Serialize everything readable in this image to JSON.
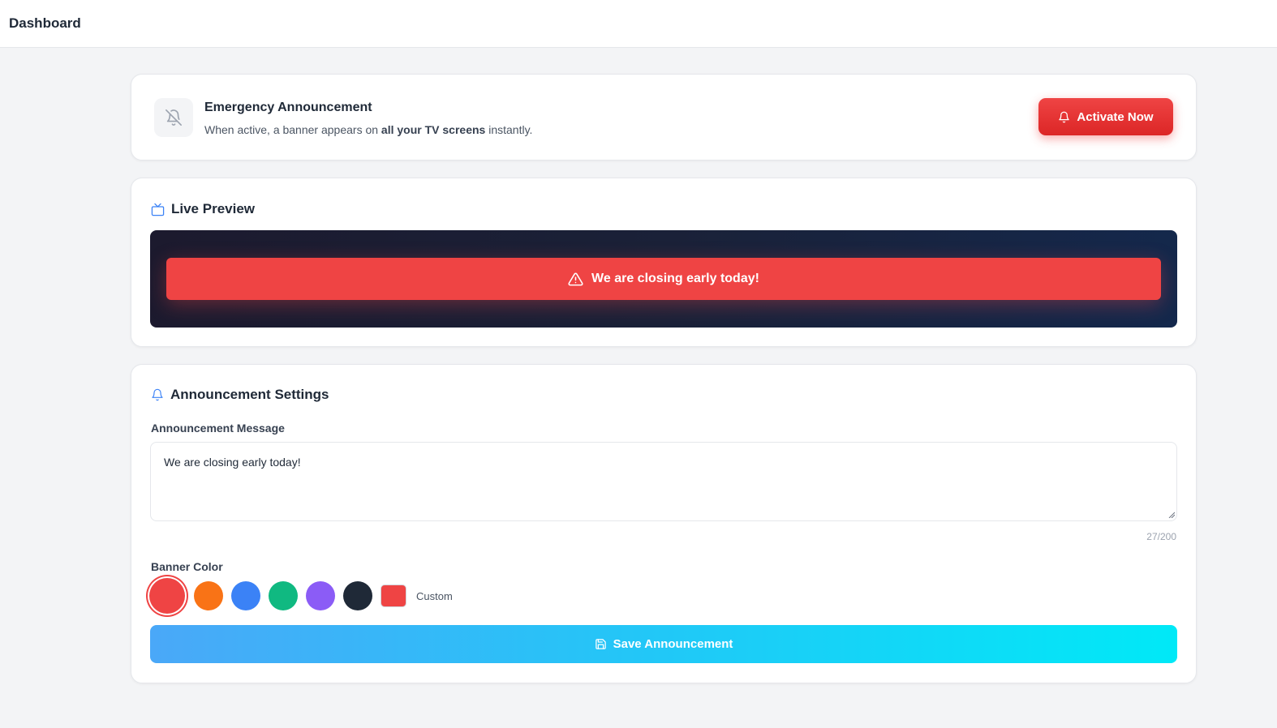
{
  "topbar": {
    "title": "Dashboard"
  },
  "emergency": {
    "title": "Emergency Announcement",
    "desc_prefix": "When active, a banner appears on ",
    "desc_bold": "all your TV screens",
    "desc_suffix": " instantly.",
    "activate_label": "Activate Now",
    "icon": "bell-off-icon"
  },
  "preview": {
    "heading": "Live Preview",
    "heading_icon": "tv-icon",
    "banner_text": "We are closing early today!",
    "banner_icon": "warning-triangle-icon",
    "banner_color": "#ef4444"
  },
  "settings": {
    "heading": "Announcement Settings",
    "heading_icon": "bell-icon",
    "message_label": "Announcement Message",
    "message_value": "We are closing early today!",
    "char_count": "27/200",
    "color_label": "Banner Color",
    "colors": [
      {
        "name": "red",
        "hex": "#ef4444",
        "selected": true
      },
      {
        "name": "orange",
        "hex": "#f97316",
        "selected": false
      },
      {
        "name": "blue",
        "hex": "#3b82f6",
        "selected": false
      },
      {
        "name": "green",
        "hex": "#10b981",
        "selected": false
      },
      {
        "name": "purple",
        "hex": "#8b5cf6",
        "selected": false
      },
      {
        "name": "dark",
        "hex": "#1f2937",
        "selected": false
      }
    ],
    "custom_color": "#ef4444",
    "custom_label": "Custom",
    "save_label": "Save Announcement",
    "save_icon": "save-icon"
  }
}
